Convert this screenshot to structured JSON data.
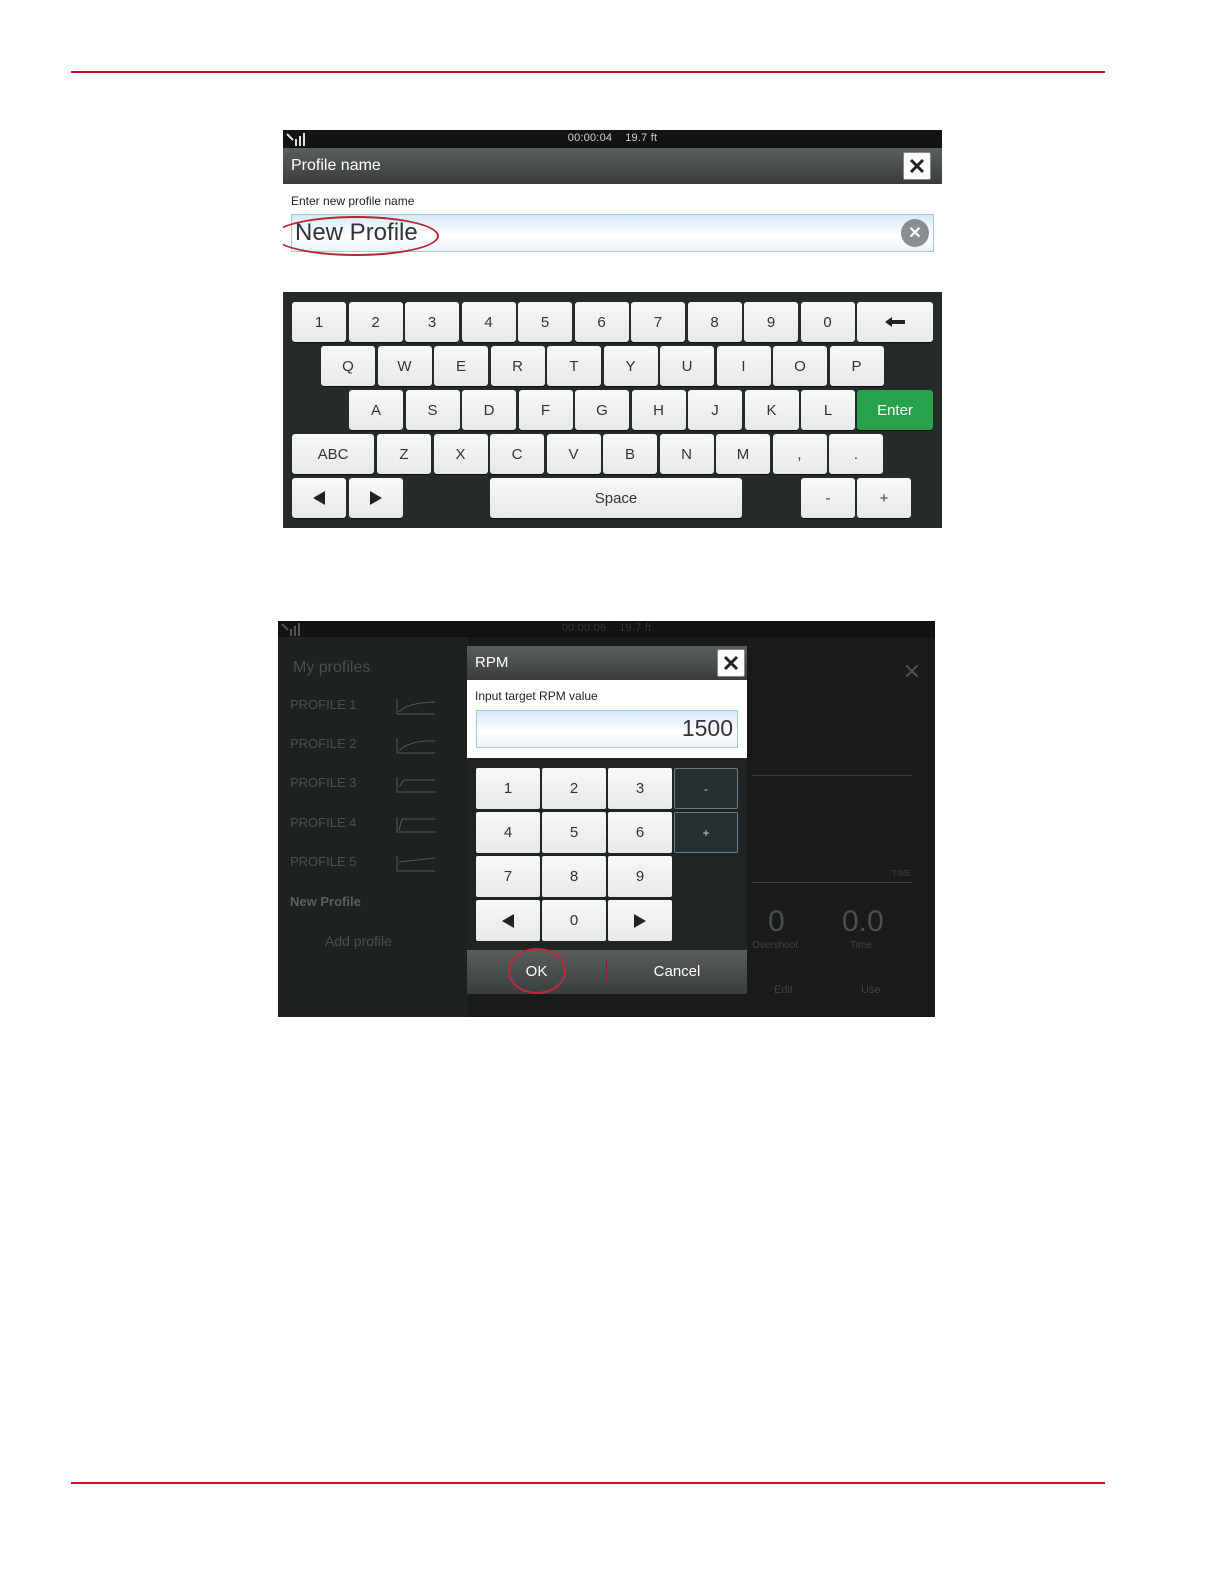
{
  "profile_name_screen": {
    "status": {
      "time": "00:00:04",
      "depth": "19.7 ft"
    },
    "title": "Profile name",
    "prompt": "Enter new profile name",
    "input_value": "New Profile",
    "keyboard": {
      "row1": [
        "1",
        "2",
        "3",
        "4",
        "5",
        "6",
        "7",
        "8",
        "9",
        "0"
      ],
      "row2": [
        "Q",
        "W",
        "E",
        "R",
        "T",
        "Y",
        "U",
        "I",
        "O",
        "P"
      ],
      "row3": [
        "A",
        "S",
        "D",
        "F",
        "G",
        "H",
        "J",
        "K",
        "L"
      ],
      "enter_label": "Enter",
      "abc_label": "ABC",
      "row4": [
        "Z",
        "X",
        "C",
        "V",
        "B",
        "N",
        "M",
        ",",
        "."
      ],
      "space_label": "Space",
      "minus_label": "-",
      "plus_label": "+",
      "icons": {
        "backspace": "←",
        "left": "◀",
        "right": "▶"
      }
    }
  },
  "rpm_screen": {
    "status": {
      "time": "00:00:06",
      "depth": "19.7 ft"
    },
    "background": {
      "title": "My profiles",
      "profiles": [
        "PROFILE 1",
        "PROFILE 2",
        "PROFILE 3",
        "PROFILE 4",
        "PROFILE 5"
      ],
      "selected_profile": "New Profile",
      "add_profile": "Add profile",
      "time_axis": "TIME",
      "overshoot_value": "0",
      "overshoot_label": "Overshoot",
      "time_value": "0.0",
      "time_label": "Time",
      "edit_label": "Edit",
      "use_label": "Use"
    },
    "dialog": {
      "title": "RPM",
      "prompt": "Input target RPM value",
      "value": "1500",
      "keys": [
        "1",
        "2",
        "3",
        "4",
        "5",
        "6",
        "7",
        "8",
        "9",
        "0"
      ],
      "minus_label": "-",
      "plus_label": "+",
      "ok_label": "OK",
      "cancel_label": "Cancel"
    }
  },
  "colors": {
    "rule": "#c8102e",
    "enter": "#27a24a",
    "highlight": "#b5252c"
  }
}
